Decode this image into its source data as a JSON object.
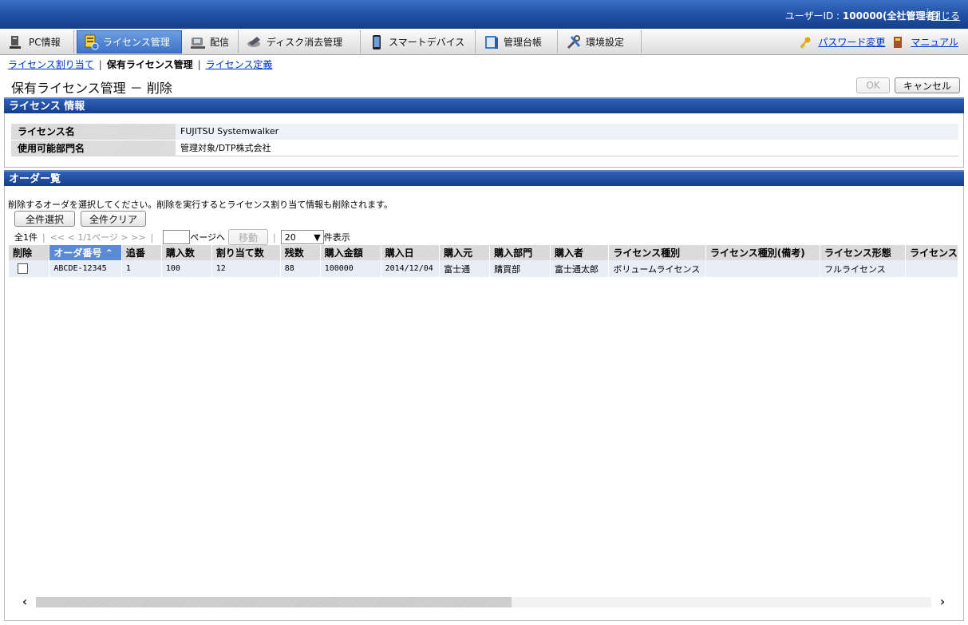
{
  "header": {
    "user_label": "ユーザーID : ",
    "user_value": "100000(全社管理者)",
    "close_label": "閉じる"
  },
  "nav": {
    "tabs": [
      {
        "label": "PC情報",
        "icon": "pc-icon"
      },
      {
        "label": "ライセンス管理",
        "icon": "license-icon"
      },
      {
        "label": "配信",
        "icon": "delivery-icon"
      },
      {
        "label": "ディスク消去管理",
        "icon": "disk-erase-icon"
      },
      {
        "label": "スマートデバイス",
        "icon": "smartphone-icon"
      },
      {
        "label": "管理台帳",
        "icon": "ledger-icon"
      },
      {
        "label": "環境設定",
        "icon": "tools-icon"
      }
    ],
    "password_label": "パスワード変更",
    "manual_label": "マニュアル"
  },
  "subnav": {
    "assign": "ライセンス割り当て",
    "owned": "保有ライセンス管理",
    "define": "ライセンス定義",
    "sep": "|"
  },
  "page": {
    "title": "保有ライセンス管理 － 削除",
    "ok_label": "OK",
    "cancel_label": "キャンセル"
  },
  "license_info": {
    "section_title": "ライセンス 情報",
    "name_key": "ライセンス名",
    "name_value": "FUJITSU Systemwalker",
    "dept_key": "使用可能部門名",
    "dept_value": "管理対象/DTP株式会社"
  },
  "orders": {
    "section_title": "オーダー覧",
    "instruction": "削除するオーダを選択してください。削除を実行するとライセンス割り当て情報も削除されます。",
    "select_all": "全件選択",
    "clear_all": "全件クリア",
    "pager": {
      "total": "全1件",
      "nav": "<< < 1/1ページ > >>",
      "goto_suffix": "ページへ",
      "move_label": "移動",
      "per_page": "20",
      "per_page_suffix": "件表示"
    },
    "columns": [
      "削除",
      "オーダ番号",
      "追番",
      "購入数",
      "割り当て数",
      "残数",
      "購入金額",
      "購入日",
      "購入元",
      "購入部門",
      "購入者",
      "ライセンス種別",
      "ライセンス種別(備考)",
      "ライセンス形態",
      "ライセンス"
    ],
    "rows": [
      [
        "",
        "ABCDE-12345",
        "1",
        "100",
        "12",
        "88",
        "100000",
        "2014/12/04",
        "富士通",
        "購買部",
        "富士通太郎",
        "ボリュームライセンス",
        "",
        "フルライセンス",
        ""
      ]
    ]
  },
  "scroll": {
    "left": "‹",
    "right": "›"
  },
  "colors": {
    "header_blue": "#1f4fa3",
    "accent": "#5b8ad6"
  }
}
